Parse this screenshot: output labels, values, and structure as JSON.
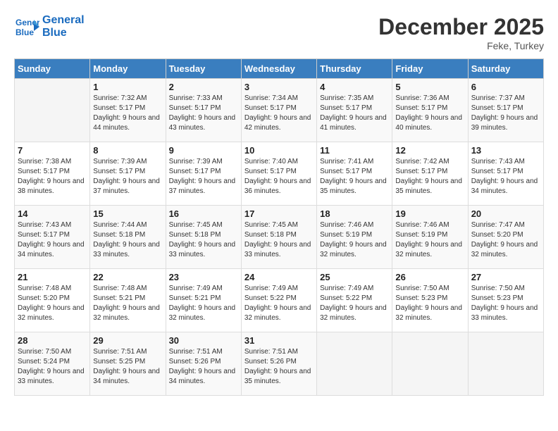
{
  "header": {
    "logo_line1": "General",
    "logo_line2": "Blue",
    "month_title": "December 2025",
    "location": "Feke, Turkey"
  },
  "weekdays": [
    "Sunday",
    "Monday",
    "Tuesday",
    "Wednesday",
    "Thursday",
    "Friday",
    "Saturday"
  ],
  "weeks": [
    [
      {
        "day": "",
        "sunrise": "",
        "sunset": "",
        "daylight": ""
      },
      {
        "day": "1",
        "sunrise": "Sunrise: 7:32 AM",
        "sunset": "Sunset: 5:17 PM",
        "daylight": "Daylight: 9 hours and 44 minutes."
      },
      {
        "day": "2",
        "sunrise": "Sunrise: 7:33 AM",
        "sunset": "Sunset: 5:17 PM",
        "daylight": "Daylight: 9 hours and 43 minutes."
      },
      {
        "day": "3",
        "sunrise": "Sunrise: 7:34 AM",
        "sunset": "Sunset: 5:17 PM",
        "daylight": "Daylight: 9 hours and 42 minutes."
      },
      {
        "day": "4",
        "sunrise": "Sunrise: 7:35 AM",
        "sunset": "Sunset: 5:17 PM",
        "daylight": "Daylight: 9 hours and 41 minutes."
      },
      {
        "day": "5",
        "sunrise": "Sunrise: 7:36 AM",
        "sunset": "Sunset: 5:17 PM",
        "daylight": "Daylight: 9 hours and 40 minutes."
      },
      {
        "day": "6",
        "sunrise": "Sunrise: 7:37 AM",
        "sunset": "Sunset: 5:17 PM",
        "daylight": "Daylight: 9 hours and 39 minutes."
      }
    ],
    [
      {
        "day": "7",
        "sunrise": "Sunrise: 7:38 AM",
        "sunset": "Sunset: 5:17 PM",
        "daylight": "Daylight: 9 hours and 38 minutes."
      },
      {
        "day": "8",
        "sunrise": "Sunrise: 7:39 AM",
        "sunset": "Sunset: 5:17 PM",
        "daylight": "Daylight: 9 hours and 37 minutes."
      },
      {
        "day": "9",
        "sunrise": "Sunrise: 7:39 AM",
        "sunset": "Sunset: 5:17 PM",
        "daylight": "Daylight: 9 hours and 37 minutes."
      },
      {
        "day": "10",
        "sunrise": "Sunrise: 7:40 AM",
        "sunset": "Sunset: 5:17 PM",
        "daylight": "Daylight: 9 hours and 36 minutes."
      },
      {
        "day": "11",
        "sunrise": "Sunrise: 7:41 AM",
        "sunset": "Sunset: 5:17 PM",
        "daylight": "Daylight: 9 hours and 35 minutes."
      },
      {
        "day": "12",
        "sunrise": "Sunrise: 7:42 AM",
        "sunset": "Sunset: 5:17 PM",
        "daylight": "Daylight: 9 hours and 35 minutes."
      },
      {
        "day": "13",
        "sunrise": "Sunrise: 7:43 AM",
        "sunset": "Sunset: 5:17 PM",
        "daylight": "Daylight: 9 hours and 34 minutes."
      }
    ],
    [
      {
        "day": "14",
        "sunrise": "Sunrise: 7:43 AM",
        "sunset": "Sunset: 5:17 PM",
        "daylight": "Daylight: 9 hours and 34 minutes."
      },
      {
        "day": "15",
        "sunrise": "Sunrise: 7:44 AM",
        "sunset": "Sunset: 5:18 PM",
        "daylight": "Daylight: 9 hours and 33 minutes."
      },
      {
        "day": "16",
        "sunrise": "Sunrise: 7:45 AM",
        "sunset": "Sunset: 5:18 PM",
        "daylight": "Daylight: 9 hours and 33 minutes."
      },
      {
        "day": "17",
        "sunrise": "Sunrise: 7:45 AM",
        "sunset": "Sunset: 5:18 PM",
        "daylight": "Daylight: 9 hours and 33 minutes."
      },
      {
        "day": "18",
        "sunrise": "Sunrise: 7:46 AM",
        "sunset": "Sunset: 5:19 PM",
        "daylight": "Daylight: 9 hours and 32 minutes."
      },
      {
        "day": "19",
        "sunrise": "Sunrise: 7:46 AM",
        "sunset": "Sunset: 5:19 PM",
        "daylight": "Daylight: 9 hours and 32 minutes."
      },
      {
        "day": "20",
        "sunrise": "Sunrise: 7:47 AM",
        "sunset": "Sunset: 5:20 PM",
        "daylight": "Daylight: 9 hours and 32 minutes."
      }
    ],
    [
      {
        "day": "21",
        "sunrise": "Sunrise: 7:48 AM",
        "sunset": "Sunset: 5:20 PM",
        "daylight": "Daylight: 9 hours and 32 minutes."
      },
      {
        "day": "22",
        "sunrise": "Sunrise: 7:48 AM",
        "sunset": "Sunset: 5:21 PM",
        "daylight": "Daylight: 9 hours and 32 minutes."
      },
      {
        "day": "23",
        "sunrise": "Sunrise: 7:49 AM",
        "sunset": "Sunset: 5:21 PM",
        "daylight": "Daylight: 9 hours and 32 minutes."
      },
      {
        "day": "24",
        "sunrise": "Sunrise: 7:49 AM",
        "sunset": "Sunset: 5:22 PM",
        "daylight": "Daylight: 9 hours and 32 minutes."
      },
      {
        "day": "25",
        "sunrise": "Sunrise: 7:49 AM",
        "sunset": "Sunset: 5:22 PM",
        "daylight": "Daylight: 9 hours and 32 minutes."
      },
      {
        "day": "26",
        "sunrise": "Sunrise: 7:50 AM",
        "sunset": "Sunset: 5:23 PM",
        "daylight": "Daylight: 9 hours and 32 minutes."
      },
      {
        "day": "27",
        "sunrise": "Sunrise: 7:50 AM",
        "sunset": "Sunset: 5:23 PM",
        "daylight": "Daylight: 9 hours and 33 minutes."
      }
    ],
    [
      {
        "day": "28",
        "sunrise": "Sunrise: 7:50 AM",
        "sunset": "Sunset: 5:24 PM",
        "daylight": "Daylight: 9 hours and 33 minutes."
      },
      {
        "day": "29",
        "sunrise": "Sunrise: 7:51 AM",
        "sunset": "Sunset: 5:25 PM",
        "daylight": "Daylight: 9 hours and 34 minutes."
      },
      {
        "day": "30",
        "sunrise": "Sunrise: 7:51 AM",
        "sunset": "Sunset: 5:26 PM",
        "daylight": "Daylight: 9 hours and 34 minutes."
      },
      {
        "day": "31",
        "sunrise": "Sunrise: 7:51 AM",
        "sunset": "Sunset: 5:26 PM",
        "daylight": "Daylight: 9 hours and 35 minutes."
      },
      {
        "day": "",
        "sunrise": "",
        "sunset": "",
        "daylight": ""
      },
      {
        "day": "",
        "sunrise": "",
        "sunset": "",
        "daylight": ""
      },
      {
        "day": "",
        "sunrise": "",
        "sunset": "",
        "daylight": ""
      }
    ]
  ]
}
